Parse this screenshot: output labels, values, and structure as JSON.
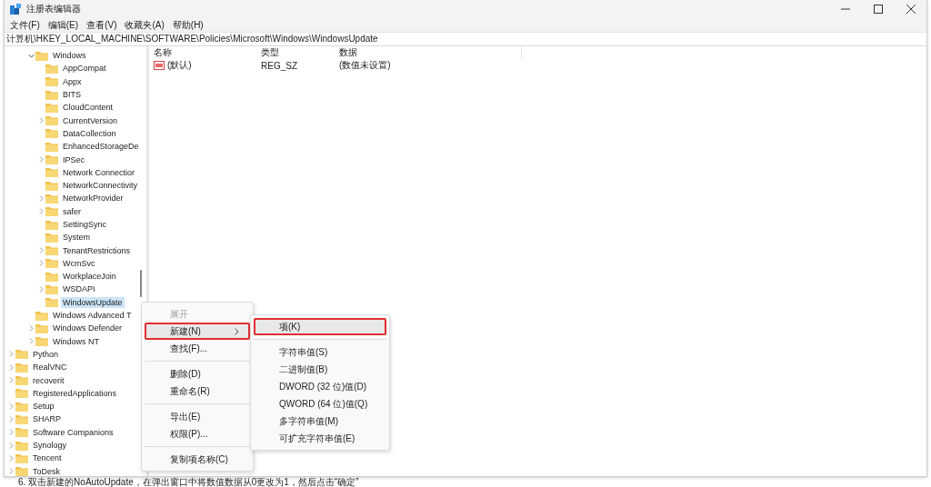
{
  "window": {
    "title": "注册表编辑器"
  },
  "menu": [
    "文件(F)",
    "编辑(E)",
    "查看(V)",
    "收藏夹(A)",
    "帮助(H)"
  ],
  "address": "计算机\\HKEY_LOCAL_MACHINE\\SOFTWARE\\Policies\\Microsoft\\Windows\\WindowsUpdate",
  "tree": [
    {
      "children": [
        {
          "label": "Windows",
          "expanded": true,
          "selected": false,
          "children": [
            {
              "label": "AppCompat",
              "selected": false
            },
            {
              "label": "Appx",
              "selected": false
            },
            {
              "label": "BITS",
              "selected": false
            },
            {
              "label": "CloudContent",
              "selected": false
            },
            {
              "label": "CurrentVersion",
              "expanded": false,
              "selected": false
            },
            {
              "label": "DataCollection",
              "selected": false
            },
            {
              "label": "EnhancedStorageDe",
              "selected": false
            },
            {
              "label": "IPSec",
              "expanded": false,
              "selected": false
            },
            {
              "label": "Network Connectior",
              "selected": false
            },
            {
              "label": "NetworkConnectivity",
              "selected": false
            },
            {
              "label": "NetworkProvider",
              "expanded": false,
              "selected": false
            },
            {
              "label": "safer",
              "expanded": false,
              "selected": false
            },
            {
              "label": "SettingSync",
              "selected": false
            },
            {
              "label": "System",
              "selected": false
            },
            {
              "label": "TenantRestrictions",
              "expanded": false,
              "selected": false
            },
            {
              "label": "WcmSvc",
              "expanded": false,
              "selected": false
            },
            {
              "label": "WorkplaceJoin",
              "selected": false
            },
            {
              "label": "WSDAPI",
              "expanded": false,
              "selected": false
            },
            {
              "label": "WindowsUpdate",
              "selected": true
            }
          ]
        },
        {
          "label": "Windows Advanced T",
          "selected": false
        },
        {
          "label": "Windows Defender",
          "expanded": false,
          "selected": false
        },
        {
          "label": "Windows NT",
          "expanded": false,
          "selected": false
        }
      ]
    },
    {
      "label": "Python",
      "expanded": false,
      "selected": false
    },
    {
      "label": "RealVNC",
      "expanded": false,
      "selected": false
    },
    {
      "label": "recoverit",
      "expanded": false,
      "selected": false
    },
    {
      "label": "RegisteredApplications",
      "selected": false
    },
    {
      "label": "Setup",
      "expanded": false,
      "selected": false
    },
    {
      "label": "SHARP",
      "expanded": false,
      "selected": false
    },
    {
      "label": "Software Companions",
      "expanded": false,
      "selected": false
    },
    {
      "label": "Synology",
      "expanded": false,
      "selected": false
    },
    {
      "label": "Tencent",
      "expanded": false,
      "selected": false
    },
    {
      "label": "ToDesk",
      "expanded": false,
      "selected": false
    }
  ],
  "values": {
    "columns": [
      "名称",
      "类型",
      "数据"
    ],
    "rows": [
      {
        "name": "(默认)",
        "type": "REG_SZ",
        "data": "(数值未设置)"
      }
    ]
  },
  "context_menu": [
    {
      "kind": "item",
      "label": "展开",
      "disabled": true,
      "selected": false,
      "annotated": false
    },
    {
      "kind": "submenu",
      "label": "新建(N)",
      "disabled": false,
      "selected": true,
      "annotated": true
    },
    {
      "kind": "item",
      "label": "查找(F)...",
      "disabled": false,
      "selected": false,
      "annotated": false
    },
    {
      "kind": "separator"
    },
    {
      "kind": "item",
      "label": "删除(D)",
      "disabled": false,
      "selected": false,
      "annotated": false
    },
    {
      "kind": "item",
      "label": "重命名(R)",
      "disabled": false,
      "selected": false,
      "annotated": false
    },
    {
      "kind": "separator"
    },
    {
      "kind": "item",
      "label": "导出(E)",
      "disabled": false,
      "selected": false,
      "annotated": false
    },
    {
      "kind": "item",
      "label": "权限(P)...",
      "disabled": false,
      "selected": false,
      "annotated": false
    },
    {
      "kind": "separator"
    },
    {
      "kind": "item",
      "label": "复制项名称(C)",
      "disabled": false,
      "selected": false,
      "annotated": false
    }
  ],
  "submenu": [
    {
      "kind": "item",
      "label": "项(K)",
      "selected": true,
      "annotated": true
    },
    {
      "kind": "separator"
    },
    {
      "kind": "item",
      "label": "字符串值(S)",
      "selected": false,
      "annotated": false
    },
    {
      "kind": "item",
      "label": "二进制值(B)",
      "selected": false,
      "annotated": false
    },
    {
      "kind": "item",
      "label": "DWORD (32 位)值(D)",
      "selected": false,
      "annotated": false
    },
    {
      "kind": "item",
      "label": "QWORD (64 位)值(Q)",
      "selected": false,
      "annotated": false
    },
    {
      "kind": "item",
      "label": "多字符串值(M)",
      "selected": false,
      "annotated": false
    },
    {
      "kind": "item",
      "label": "可扩充字符串值(E)",
      "selected": false,
      "annotated": false
    }
  ],
  "caption": "6. 双击新建的NoAutoUpdate，在弹出窗口中将数值数据从0更改为1，然后点击“确定”"
}
